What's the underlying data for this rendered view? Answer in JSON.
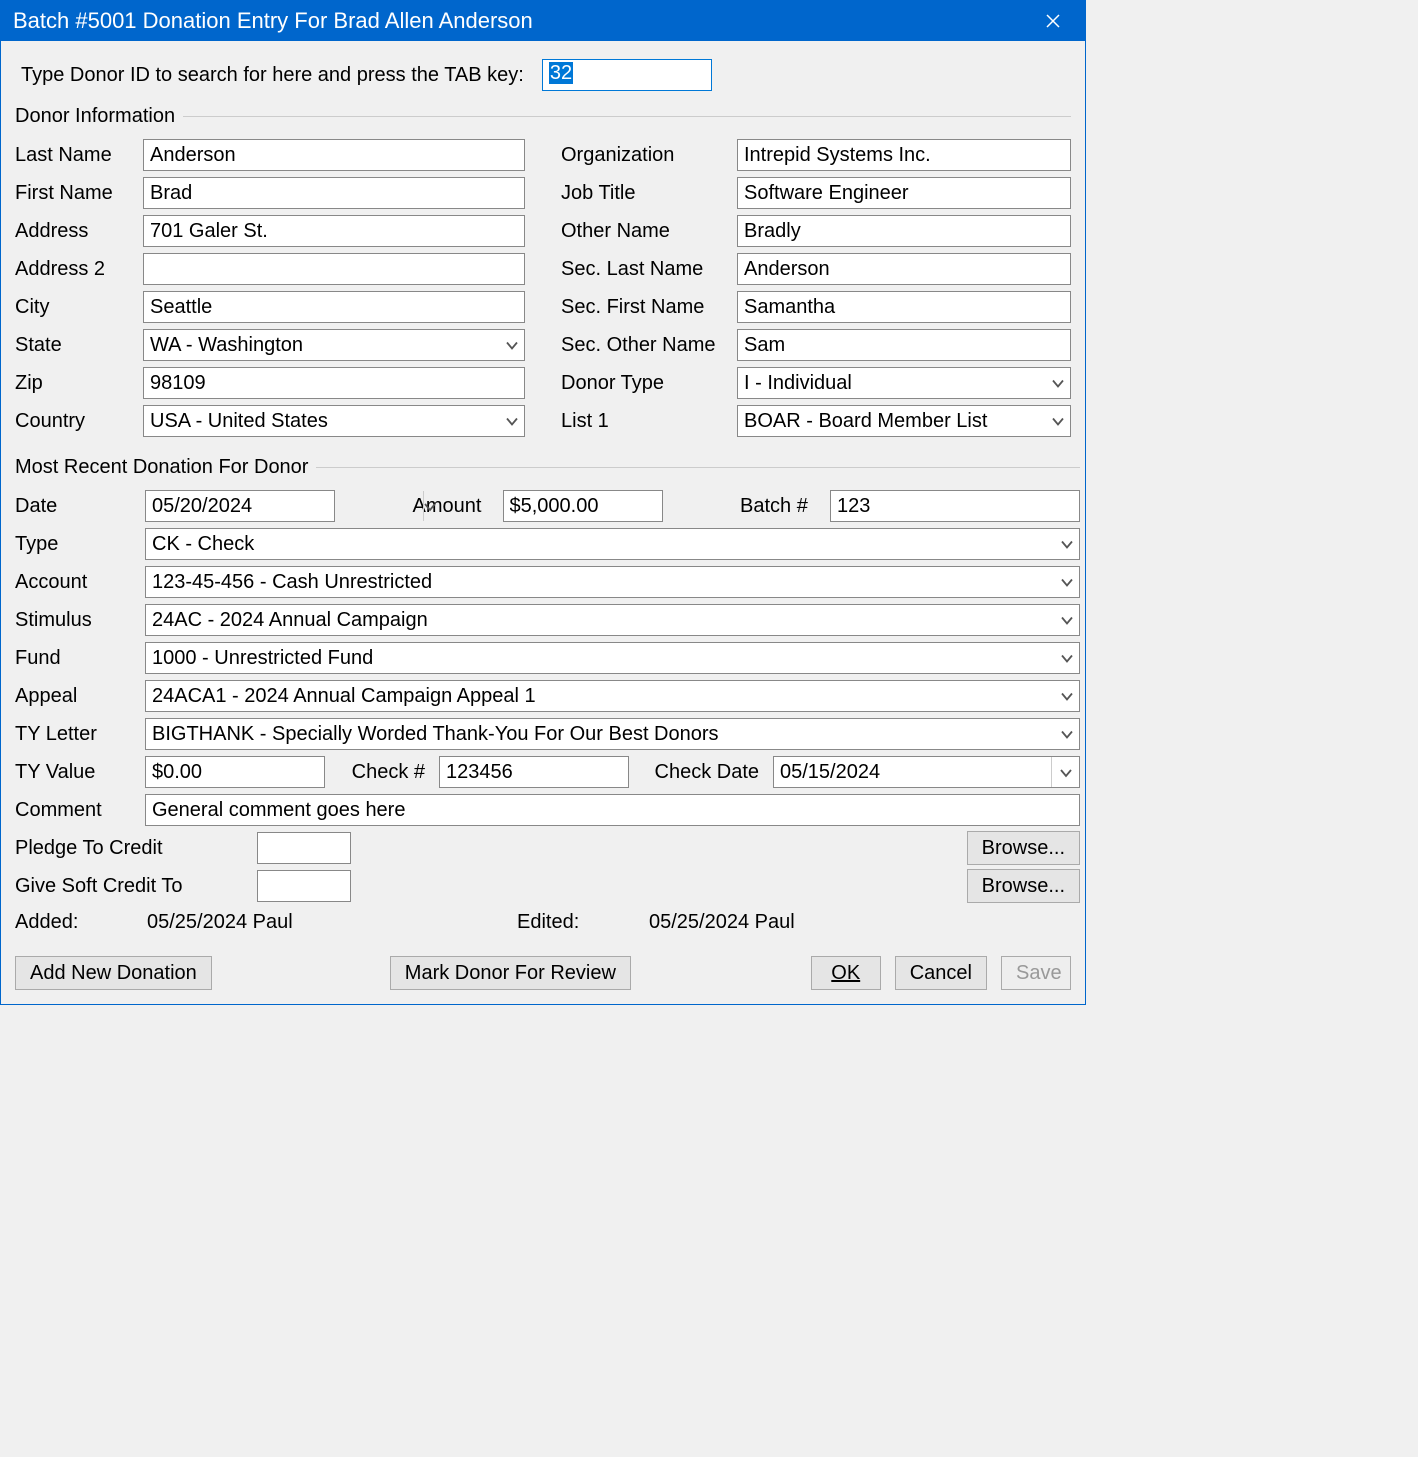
{
  "title": "Batch #5001 Donation Entry For Brad Allen Anderson",
  "search": {
    "label": "Type Donor ID to search for here and press the TAB key:",
    "value": "32"
  },
  "donorInfoLegend": "Donor Information",
  "donor": {
    "lastNameLbl": "Last Name",
    "lastName": "Anderson",
    "firstNameLbl": "First Name",
    "firstName": "Brad",
    "addressLbl": "Address",
    "address": "701 Galer St.",
    "address2Lbl": "Address 2",
    "address2": "",
    "cityLbl": "City",
    "city": "Seattle",
    "stateLbl": "State",
    "state": "WA - Washington",
    "zipLbl": "Zip",
    "zip": "98109",
    "countryLbl": "Country",
    "country": "USA - United States",
    "orgLbl": "Organization",
    "org": "Intrepid Systems Inc.",
    "jobLbl": "Job Title",
    "job": "Software Engineer",
    "otherLbl": "Other Name",
    "other": "Bradly",
    "secLastLbl": "Sec. Last Name",
    "secLast": "Anderson",
    "secFirstLbl": "Sec. First Name",
    "secFirst": "Samantha",
    "secOtherLbl": "Sec. Other Name",
    "secOther": "Sam",
    "donorTypeLbl": "Donor Type",
    "donorType": "I - Individual",
    "list1Lbl": "List 1",
    "list1": "BOAR - Board Member List"
  },
  "recentLegend": "Most Recent Donation For Donor",
  "donation": {
    "dateLbl": "Date",
    "date": "05/20/2024",
    "amountLbl": "Amount",
    "amount": "$5,000.00",
    "batchLbl": "Batch #",
    "batch": "123",
    "typeLbl": "Type",
    "type": "CK - Check",
    "accountLbl": "Account",
    "account": "123-45-456 - Cash Unrestricted",
    "stimulusLbl": "Stimulus",
    "stimulus": "24AC - 2024 Annual Campaign",
    "fundLbl": "Fund",
    "fund": "1000 - Unrestricted Fund",
    "appealLbl": "Appeal",
    "appeal": "24ACA1 - 2024 Annual Campaign Appeal 1",
    "tyLetterLbl": "TY Letter",
    "tyLetter": "BIGTHANK - Specially Worded Thank-You For Our Best Donors",
    "tyValueLbl": "TY Value",
    "tyValue": "$0.00",
    "checkNoLbl": "Check #",
    "checkNo": "123456",
    "checkDateLbl": "Check Date",
    "checkDate": "05/15/2024",
    "commentLbl": "Comment",
    "comment": "General comment goes here",
    "pledgeLbl": "Pledge To Credit",
    "pledge": "",
    "softLbl": "Give Soft Credit To",
    "softCredit": "",
    "browse": "Browse...",
    "addedLbl": "Added:",
    "added": "05/25/2024 Paul",
    "editedLbl": "Edited:",
    "edited": "05/25/2024 Paul"
  },
  "buttons": {
    "addNew": "Add New Donation",
    "markReview": "Mark Donor For Review",
    "ok": "OK",
    "cancel": "Cancel",
    "save": "Save"
  }
}
